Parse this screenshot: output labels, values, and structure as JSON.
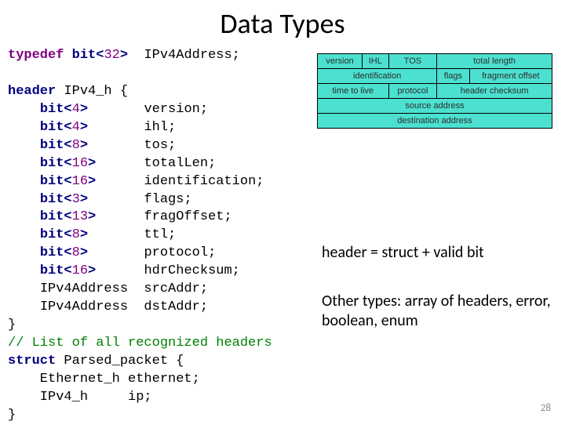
{
  "title": "Data Types",
  "code": {
    "l01a": "typedef",
    "l01b": " bit",
    "l01c": "32",
    "l01d": "IPv4Address;",
    "l02a": "header",
    "l02b": " IPv4_h {",
    "l03a": "bit",
    "l03b": "4",
    "l03c": "version;",
    "l04a": "bit",
    "l04b": "4",
    "l04c": "ihl;",
    "l05a": "bit",
    "l05b": "8",
    "l05c": "tos;",
    "l06a": "bit",
    "l06b": "16",
    "l06c": "totalLen;",
    "l07a": "bit",
    "l07b": "16",
    "l07c": "identification;",
    "l08a": "bit",
    "l08b": "3",
    "l08c": "flags;",
    "l09a": "bit",
    "l09b": "13",
    "l09c": "fragOffset;",
    "l10a": "bit",
    "l10b": "8",
    "l10c": "ttl;",
    "l11a": "bit",
    "l11b": "8",
    "l11c": "protocol;",
    "l12a": "bit",
    "l12b": "16",
    "l12c": "hdrChecksum;",
    "l13a": "IPv4Address  srcAddr;",
    "l14a": "IPv4Address  dstAddr;",
    "l15": "}",
    "l16": "// List of all recognized headers",
    "l17a": "struct",
    "l17b": " Parsed_packet {",
    "l18": "    Ethernet_h ethernet;",
    "l19": "    IPv4_h     ip;",
    "l20": "}"
  },
  "diagram": {
    "r1": [
      "version",
      "IHL",
      "TOS",
      "total length"
    ],
    "r2": [
      "identification",
      "flags",
      "fragment offset"
    ],
    "r3": [
      "time to live",
      "protocol",
      "header checksum"
    ],
    "r4": "source address",
    "r5": "destination address"
  },
  "sidetext": {
    "line1": "header = struct + valid bit",
    "line2": "Other types: array of headers, error, boolean, enum"
  },
  "pagenum": "28"
}
